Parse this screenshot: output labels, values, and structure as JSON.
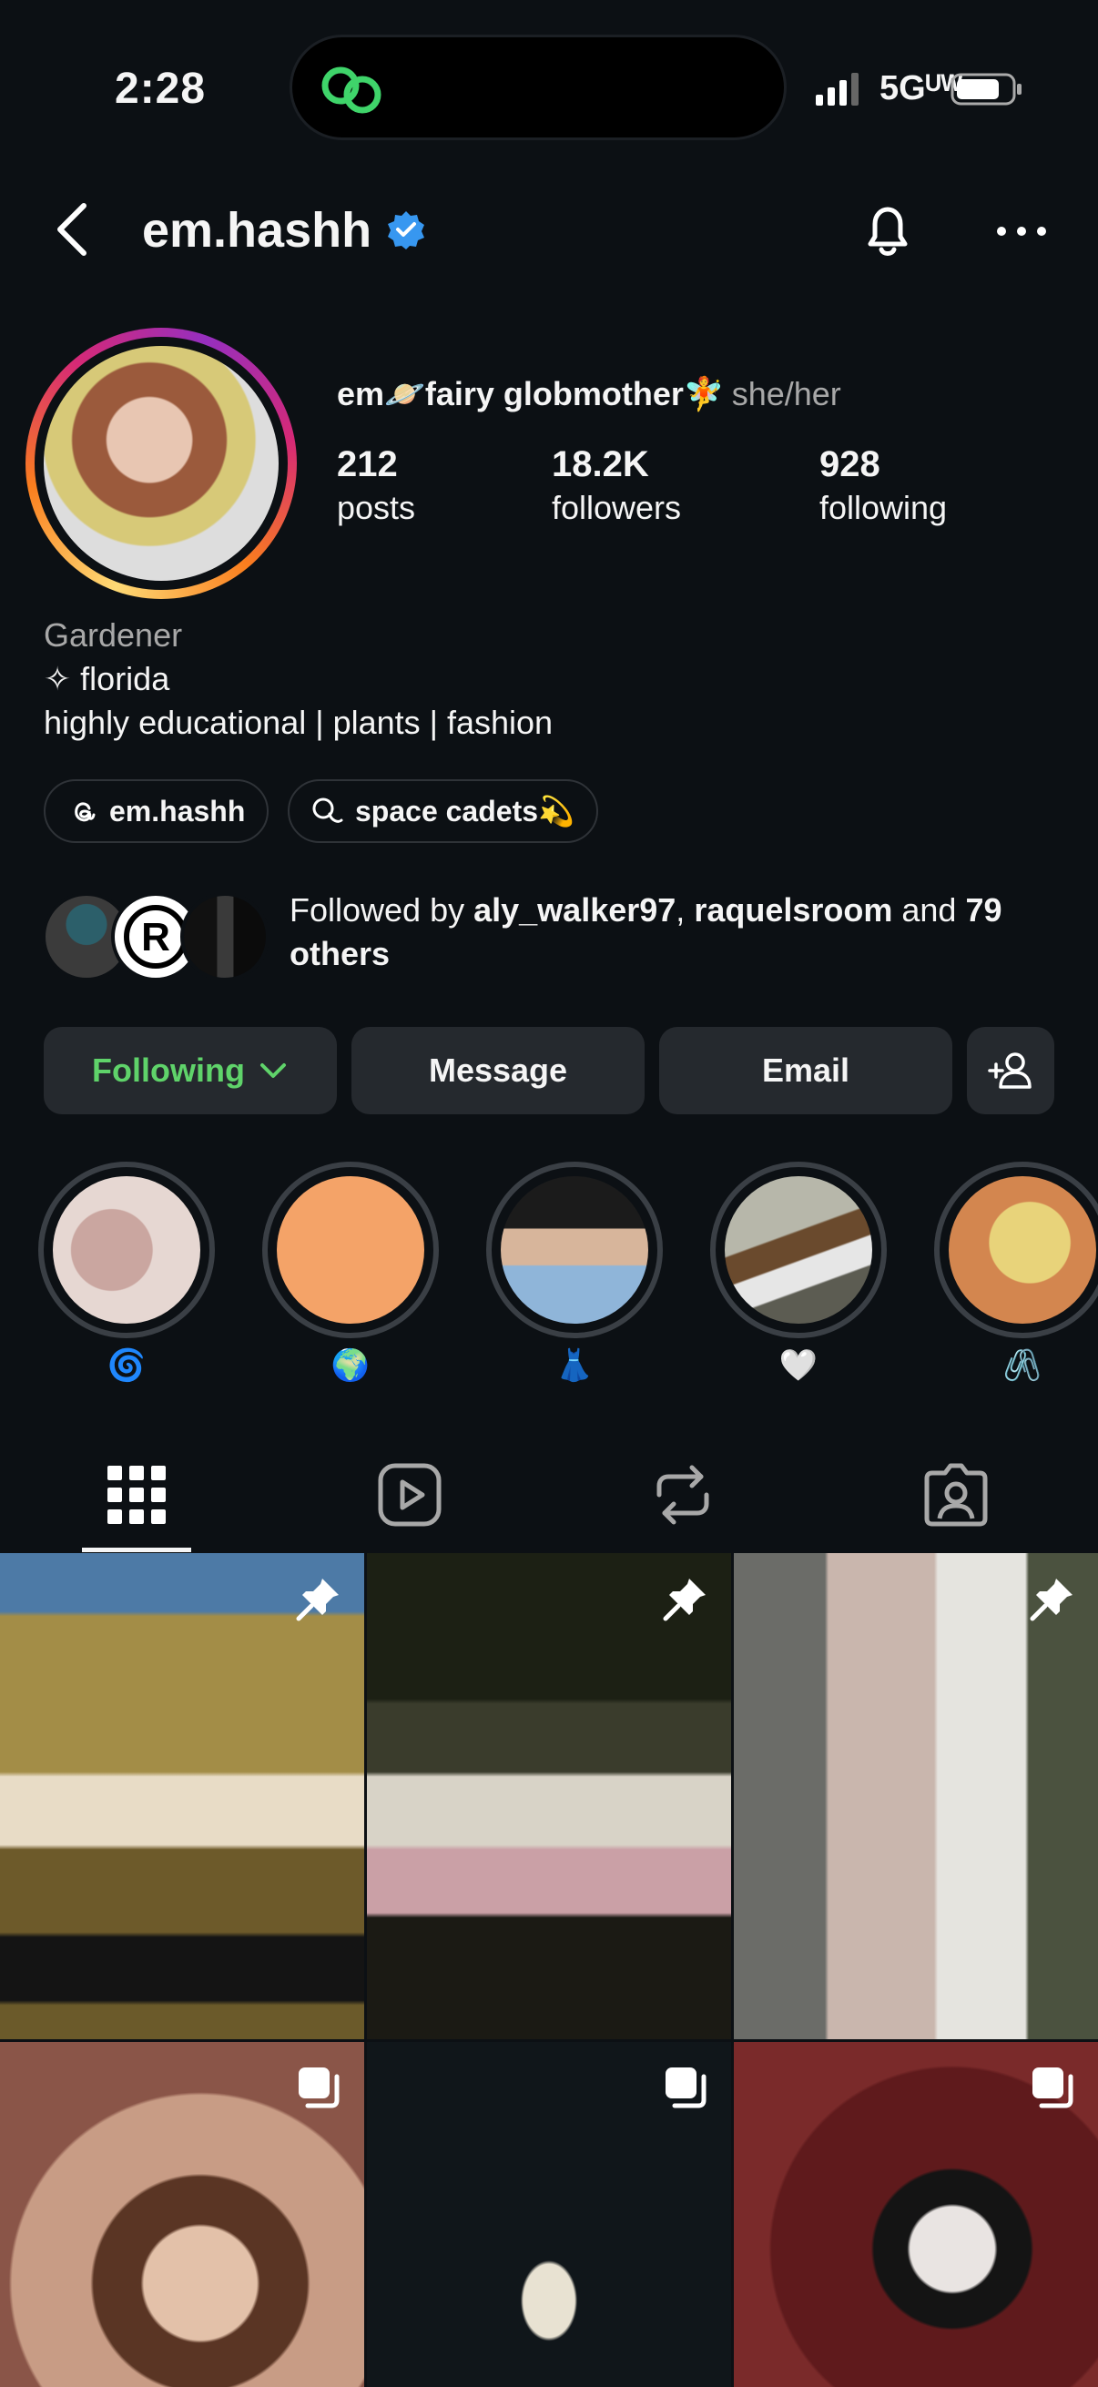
{
  "status_bar": {
    "time": "2:28",
    "network": "5Gᵁᵂ"
  },
  "header": {
    "username": "em.hashh"
  },
  "profile": {
    "display_name": "em🪐fairy globmother🧚",
    "pronouns": "she/her",
    "stats": [
      {
        "value": "212",
        "label": "posts"
      },
      {
        "value": "18.2K",
        "label": "followers"
      },
      {
        "value": "928",
        "label": "following"
      }
    ],
    "bio": {
      "category": "Gardener",
      "line1": "✧ florida",
      "line2": "highly educational | plants | fashion"
    },
    "chips": [
      {
        "label": "em.hashh",
        "icon": "threads-icon"
      },
      {
        "label": "space cadets💫",
        "icon": "chat-bubbles-icon"
      }
    ],
    "followed_by": {
      "prefix": "Followed by ",
      "user1": "aly_walker97",
      "sep": ", ",
      "user2": "raquelsroom",
      "and": " and ",
      "others": "79 others"
    }
  },
  "buttons": {
    "following": "Following",
    "message": "Message",
    "email": "Email"
  },
  "highlights": [
    {
      "label": "🌀"
    },
    {
      "label": "🌍"
    },
    {
      "label": "👗"
    },
    {
      "label": "🤍"
    },
    {
      "label": "🖇️"
    }
  ],
  "tabs": [
    "grid-icon",
    "reels-icon",
    "reposts-icon",
    "tagged-icon"
  ],
  "colors": {
    "accent_following": "#5fd36a",
    "verified": "#3797f0",
    "background": "#0c1014"
  }
}
